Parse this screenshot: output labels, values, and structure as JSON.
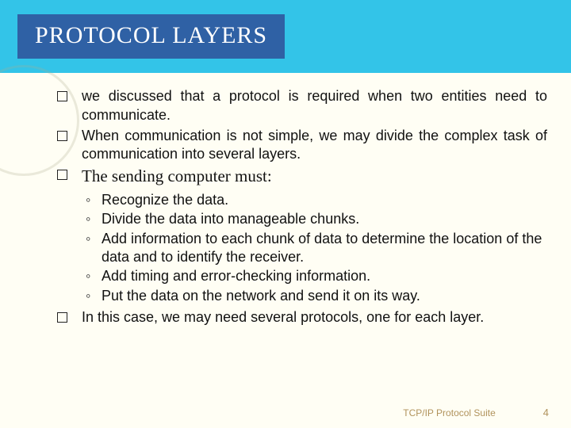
{
  "header": {
    "title": "PROTOCOL LAYERS"
  },
  "bullets": {
    "b0": "we discussed that a protocol is required when two entities need to communicate.",
    "b1": "When communication is not simple, we may divide the complex task of communication into several layers.",
    "b2": "The sending computer must:",
    "b3": "In this case, we may need several protocols, one for each layer."
  },
  "subs": {
    "s0": "Recognize the data.",
    "s1": "Divide the data into manageable chunks.",
    "s2": "Add information to each chunk of data to determine the location of the data and to identify the receiver.",
    "s3": "Add timing and error-checking information.",
    "s4": "Put the data on the network and send it on its way."
  },
  "footer": {
    "source": "TCP/IP Protocol Suite",
    "page": "4"
  }
}
